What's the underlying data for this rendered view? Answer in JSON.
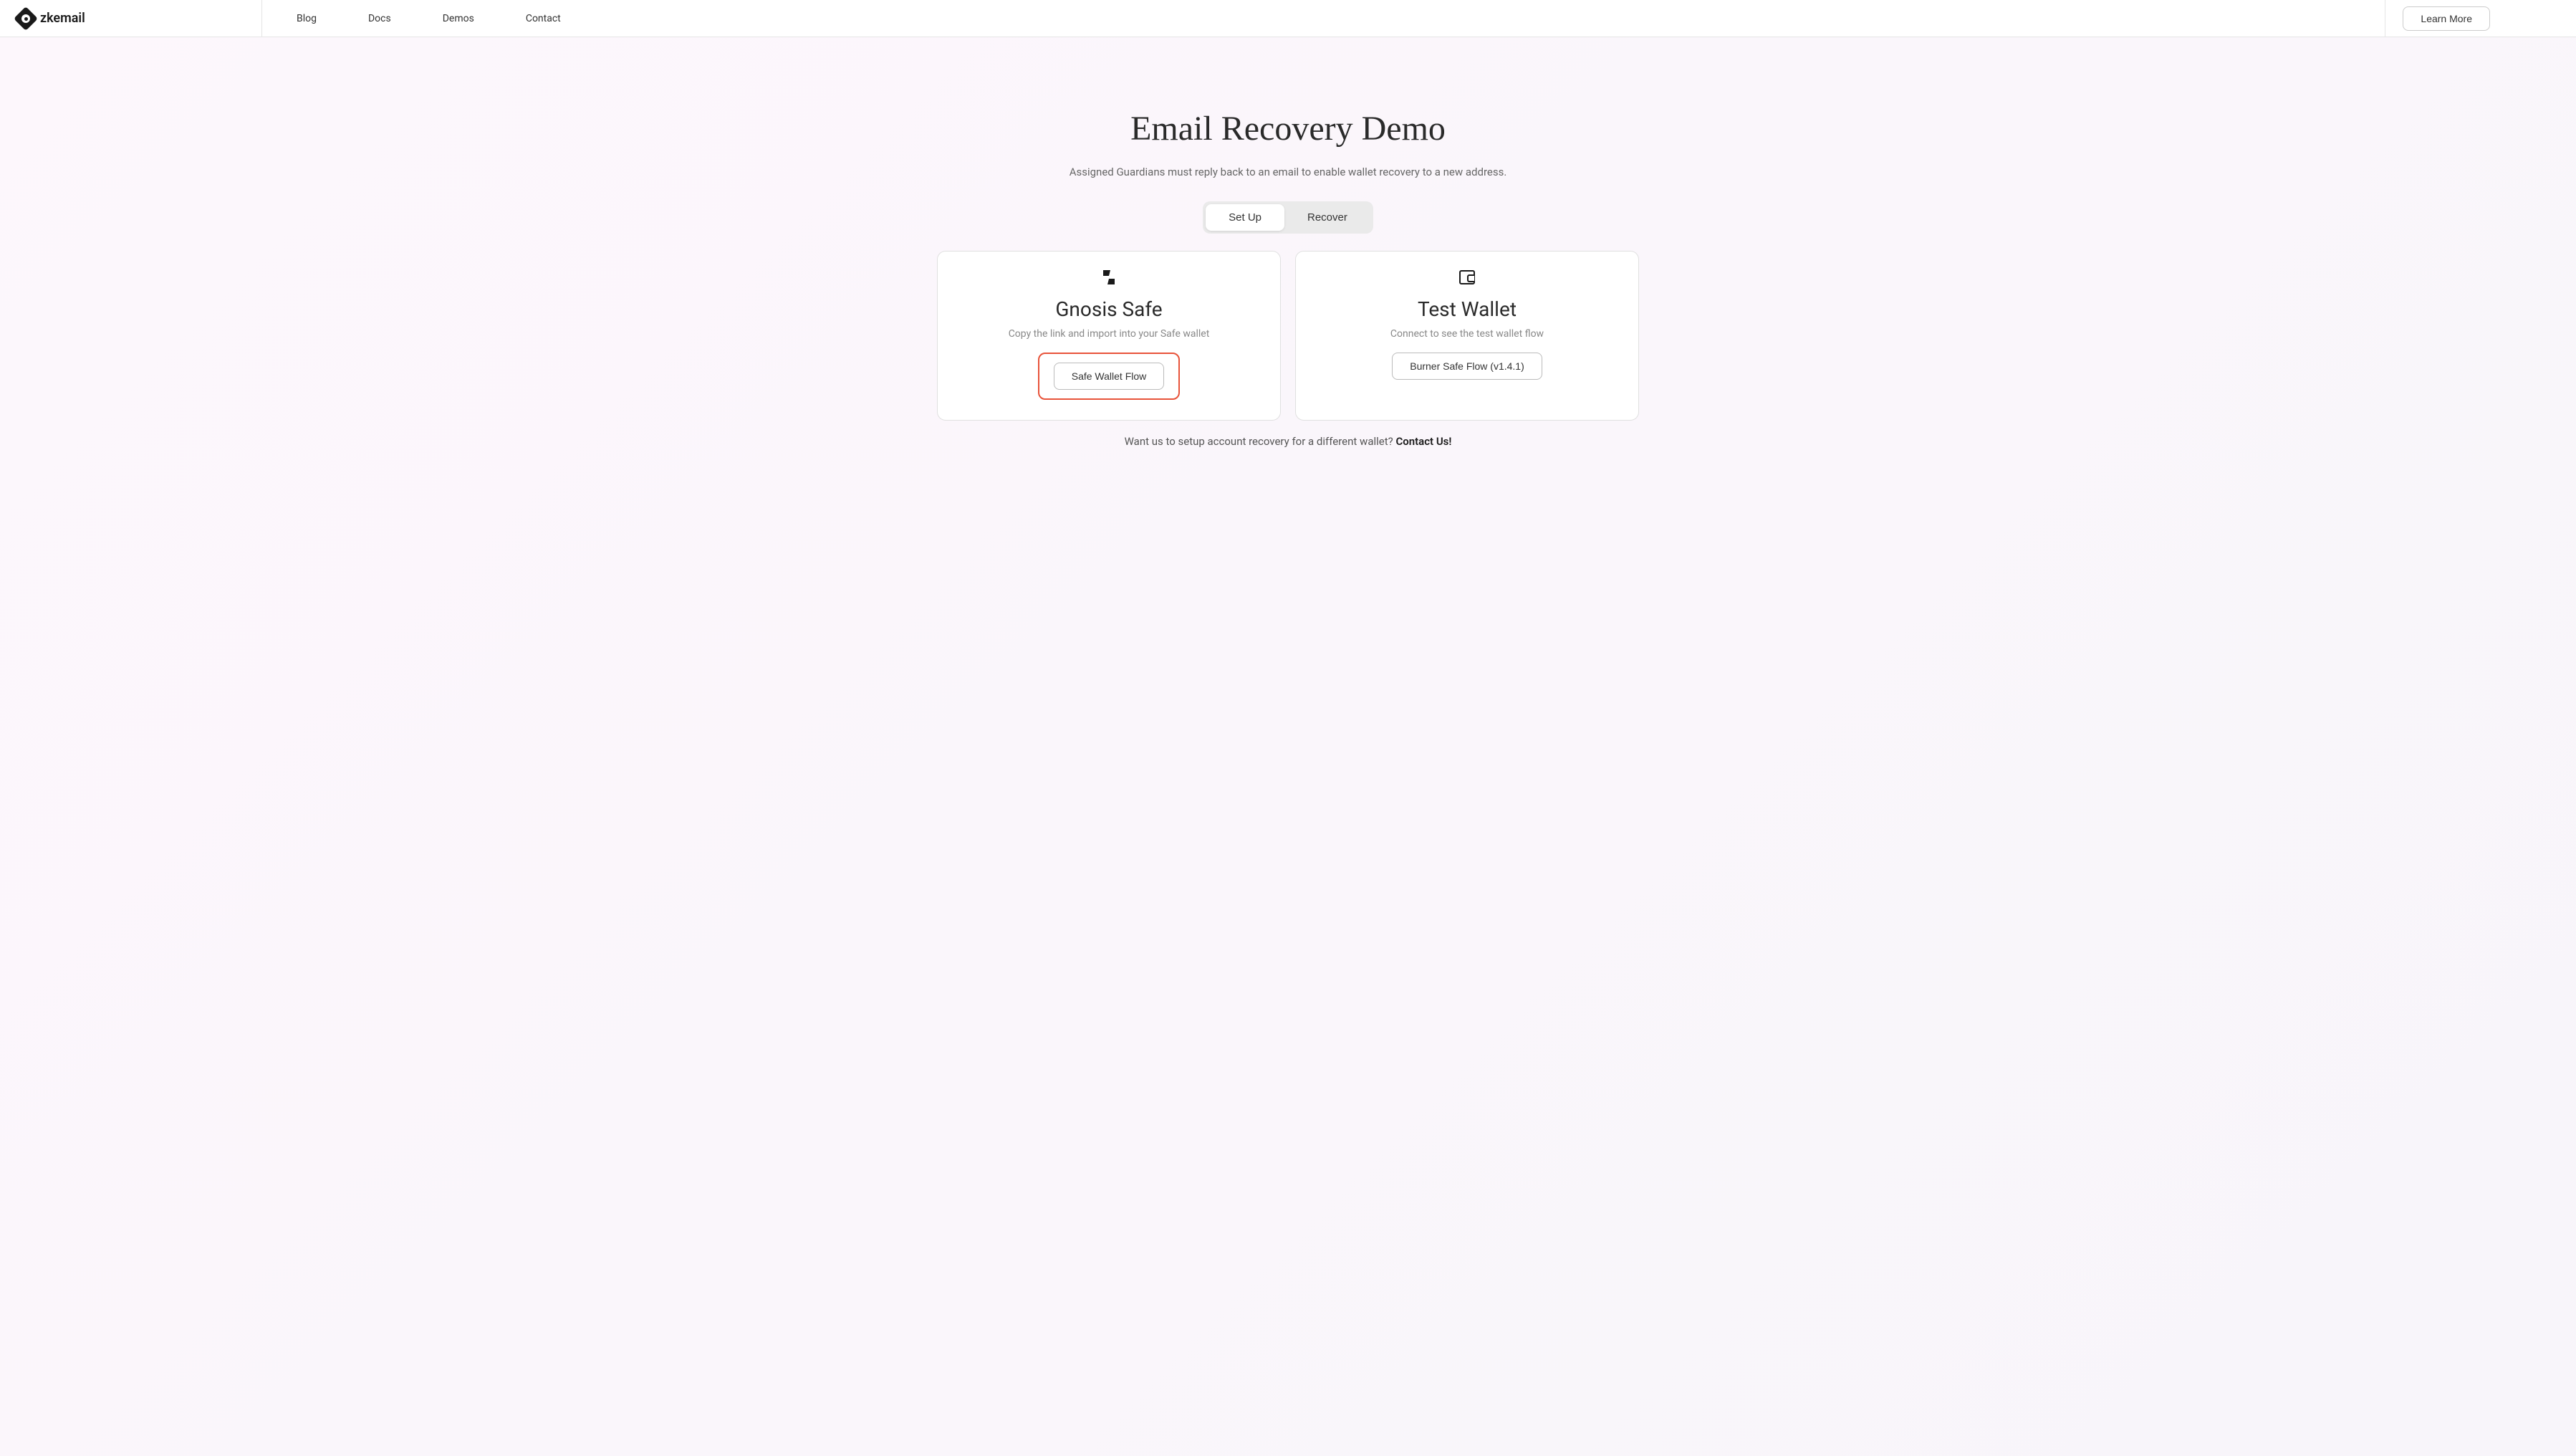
{
  "header": {
    "logo_text": "zkemail",
    "nav": {
      "blog": "Blog",
      "docs": "Docs",
      "demos": "Demos",
      "contact": "Contact"
    },
    "learn_more": "Learn More"
  },
  "main": {
    "title": "Email Recovery Demo",
    "subtitle": "Assigned Guardians must reply back to an email to enable wallet recovery to a new address.",
    "tabs": {
      "setup": "Set Up",
      "recover": "Recover"
    },
    "cards": {
      "gnosis": {
        "title": "Gnosis Safe",
        "description": "Copy the link and import into your Safe wallet",
        "button": "Safe Wallet Flow"
      },
      "test_wallet": {
        "title": "Test Wallet",
        "description": "Connect to see the test wallet flow",
        "button": "Burner Safe Flow (v1.4.1)"
      }
    },
    "footer_text": "Want us to setup account recovery for a different wallet? ",
    "contact_us": "Contact Us!"
  }
}
